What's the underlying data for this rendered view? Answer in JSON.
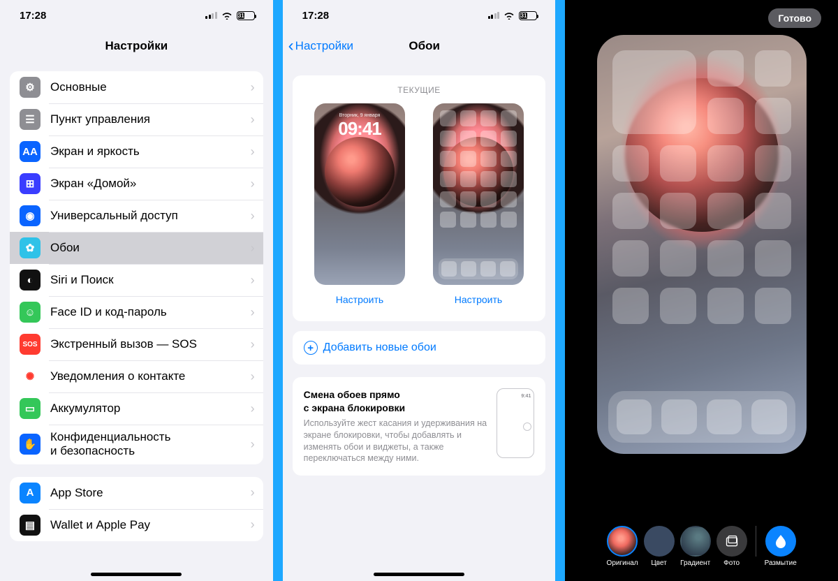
{
  "status": {
    "time": "17:28",
    "battery": "31",
    "battery_pct": 31
  },
  "settings": {
    "title": "Настройки",
    "group1": [
      {
        "color": "#8e8e93",
        "text": "⚙︎",
        "label": "Основные"
      },
      {
        "color": "#8e8e93",
        "text": "☰",
        "label": "Пункт управления"
      },
      {
        "color": "#0a64ff",
        "text": "AA",
        "label": "Экран и яркость"
      },
      {
        "color": "#3a3dff",
        "text": "⊞",
        "label": "Экран «Домой»"
      },
      {
        "color": "#0a64ff",
        "text": "◉",
        "label": "Универсальный доступ"
      },
      {
        "color": "#2fc2e8",
        "text": "✿",
        "label": "Обои",
        "selected": true
      },
      {
        "color": "#111",
        "text": "◐",
        "label": "Siri и Поиск"
      },
      {
        "color": "#34c759",
        "text": "☺",
        "label": "Face ID и код-пароль"
      },
      {
        "color": "#ff3b30",
        "text": "SOS",
        "label": "Экстренный вызов — SOS"
      },
      {
        "color": "#fff",
        "textcolor": "#ff3b30",
        "text": "✺",
        "label": "Уведомления о контакте"
      },
      {
        "color": "#34c759",
        "text": "▭",
        "label": "Аккумулятор"
      },
      {
        "color": "#0a64ff",
        "text": "✋",
        "label": "Конфиденциальность\nи безопасность"
      }
    ],
    "group2": [
      {
        "color": "#0a84ff",
        "text": "A",
        "label": "App Store"
      },
      {
        "color": "#111",
        "text": "▤",
        "label": "Wallet и Apple Pay"
      }
    ]
  },
  "wallpaper": {
    "back": "Настройки",
    "title": "Обои",
    "current": "ТЕКУЩИЕ",
    "lock_date": "Вторник, 9 января",
    "lock_time": "09:41",
    "customize": "Настроить",
    "add": "Добавить новые обои",
    "tip_title": "Смена обоев прямо\nс экрана блокировки",
    "tip_body": "Используйте жест касания и удерживания на экране блокировки, чтобы добавлять и изменять обои и виджеты, а также переключаться между ними.",
    "mini_time": "9:41"
  },
  "customize": {
    "done": "Готово",
    "options": {
      "original": "Оригинал",
      "color": "Цвет",
      "gradient": "Градиент",
      "photo": "Фото",
      "blur": "Размытие"
    }
  }
}
